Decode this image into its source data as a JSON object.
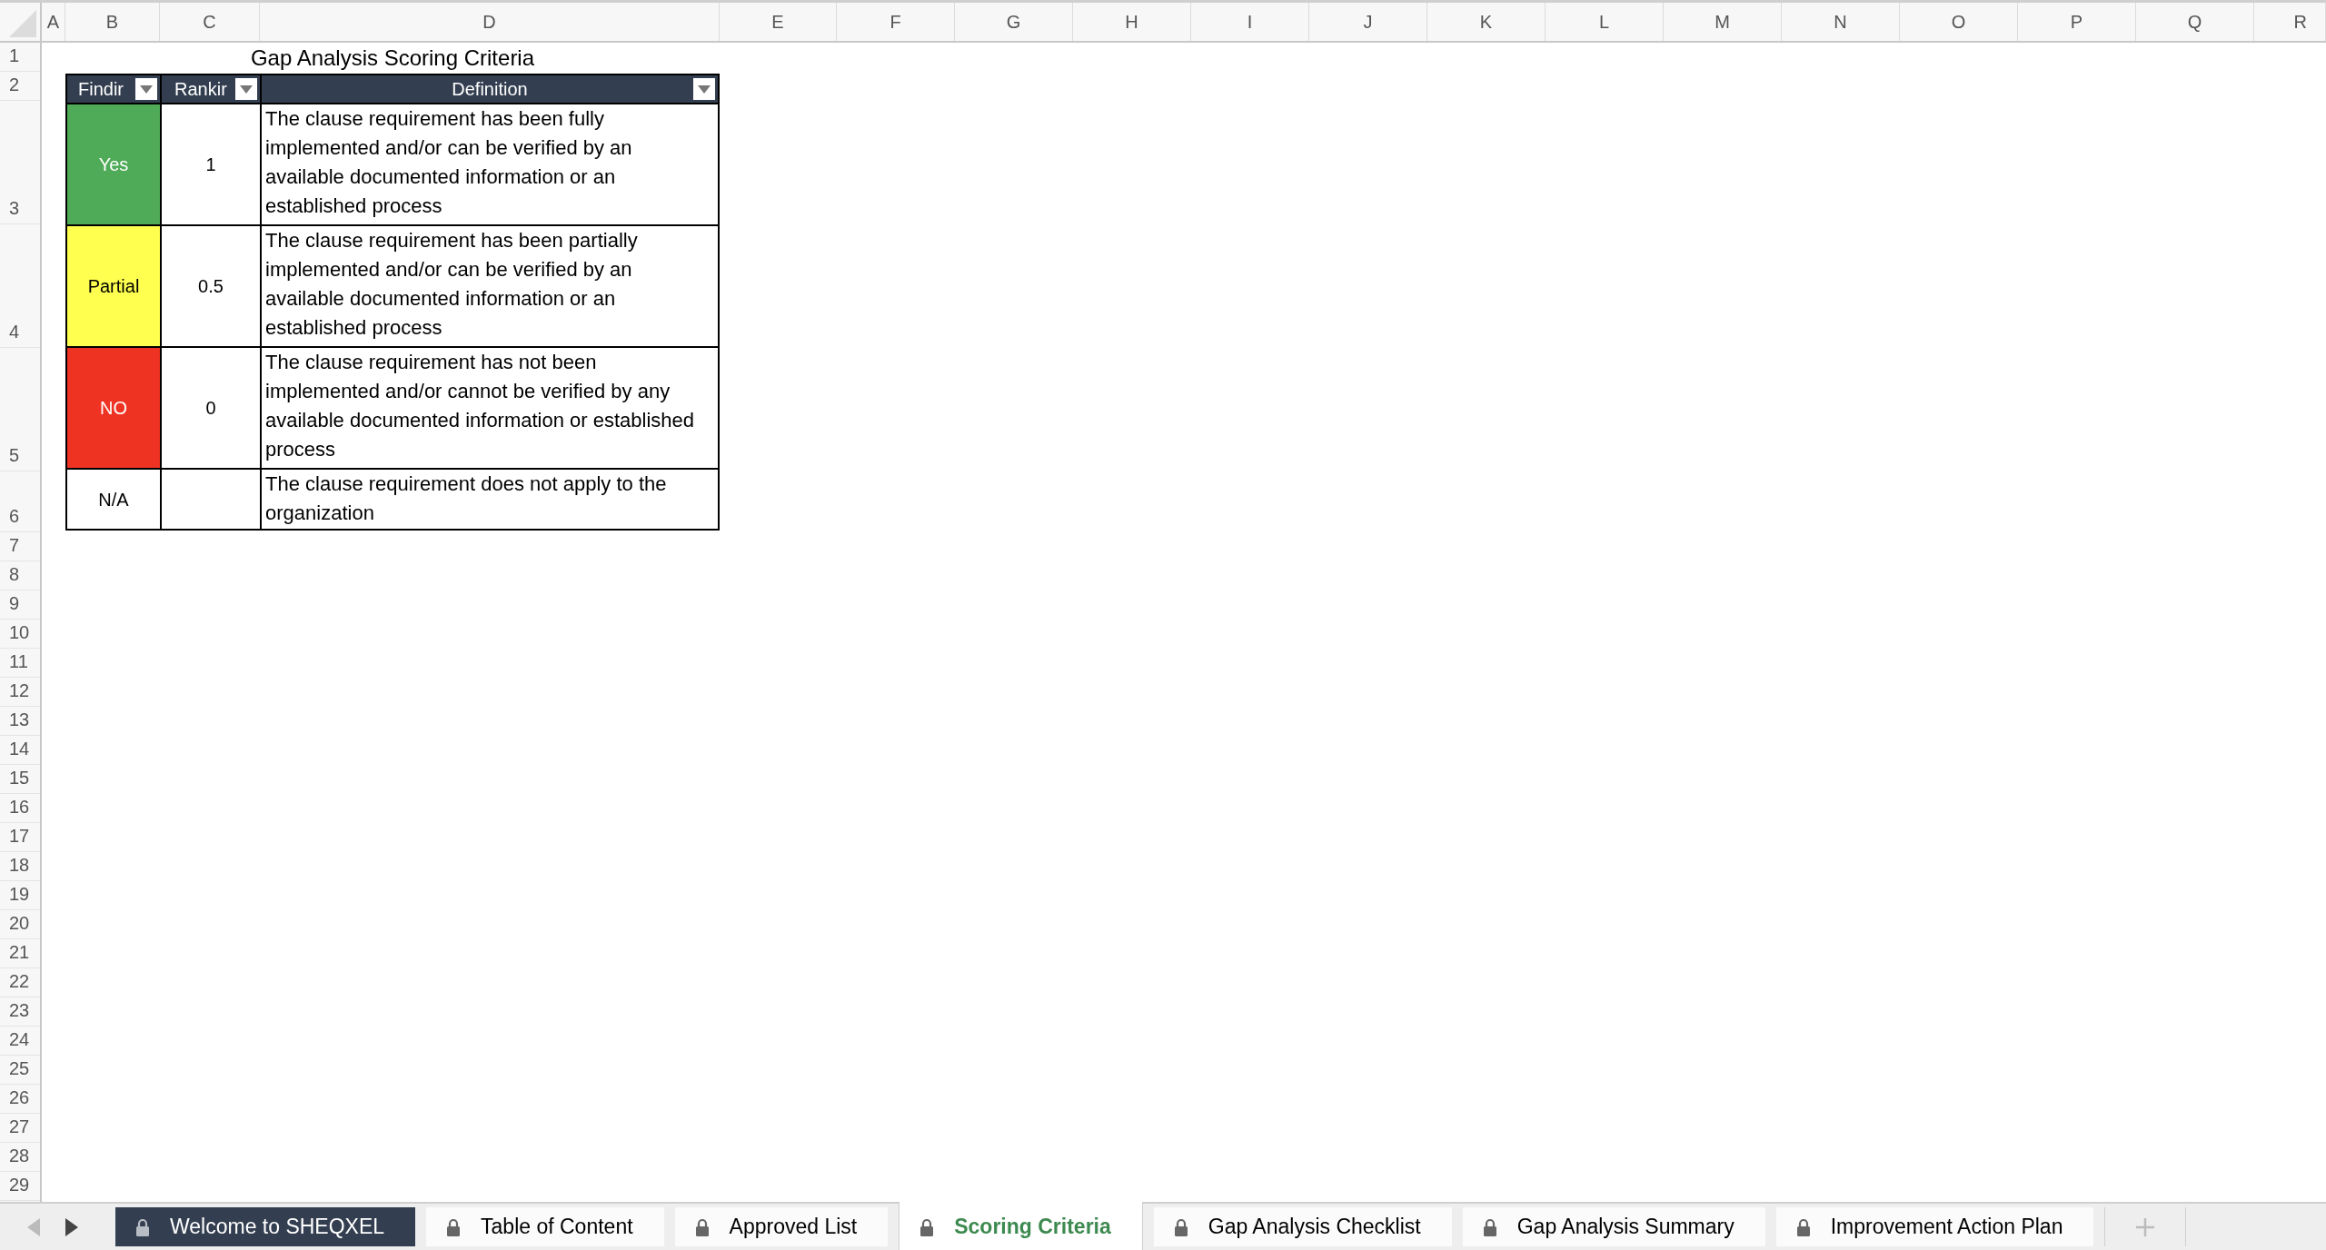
{
  "columns": [
    "A",
    "B",
    "C",
    "D",
    "E",
    "F",
    "G",
    "H",
    "I",
    "J",
    "K",
    "L",
    "M",
    "N",
    "O",
    "P",
    "Q",
    "R"
  ],
  "rows": [
    "1",
    "2",
    "3",
    "4",
    "5",
    "6",
    "7",
    "8",
    "9",
    "10",
    "11",
    "12",
    "13",
    "14",
    "15",
    "16",
    "17",
    "18",
    "19",
    "20",
    "21",
    "22",
    "23",
    "24",
    "25",
    "26",
    "27",
    "28",
    "29"
  ],
  "title": "Gap Analysis Scoring Criteria",
  "table": {
    "columns": [
      {
        "label": "Findir",
        "filter": true
      },
      {
        "label": "Rankir",
        "filter": true
      },
      {
        "label": "Definition",
        "filter": true
      }
    ],
    "rows": [
      {
        "finding": "Yes",
        "color": "#4fab57",
        "ranking": "1",
        "definition": "The clause requirement has been fully implemented and/or can be verified by an available documented information or an established process"
      },
      {
        "finding": "Partial",
        "color": "#ffff4f",
        "ranking": "0.5",
        "definition": "The clause requirement has been partially implemented and/or can be verified by an available documented information or an established process"
      },
      {
        "finding": "NO",
        "color": "#ee3323",
        "ranking": "0",
        "definition": "The clause requirement has not been implemented and/or cannot be verified by any available documented information or established process"
      },
      {
        "finding": "N/A",
        "color": "#ffffff",
        "definition": "The clause requirement does not apply to the organization"
      }
    ]
  },
  "sheet_tabs": [
    {
      "label": "Welcome to SHEQXEL",
      "locked": true,
      "selected": false,
      "color": "#333f50"
    },
    {
      "label": "Table of Content",
      "locked": true,
      "selected": false
    },
    {
      "label": "Approved List",
      "locked": true,
      "selected": false
    },
    {
      "label": "Scoring Criteria",
      "locked": true,
      "selected": true
    },
    {
      "label": "Gap Analysis Checklist",
      "locked": true,
      "selected": false
    },
    {
      "label": "Gap Analysis Summary",
      "locked": true,
      "selected": false
    },
    {
      "label": "Improvement Action Plan",
      "locked": true,
      "selected": false
    }
  ]
}
